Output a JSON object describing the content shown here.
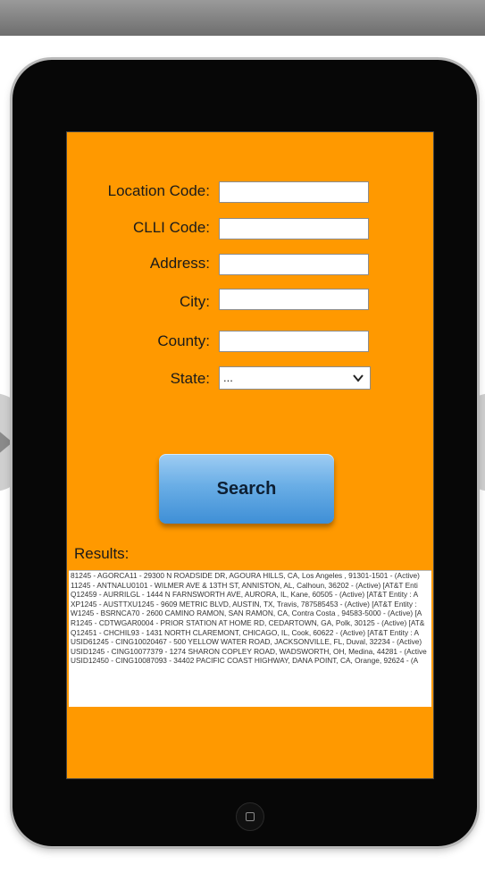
{
  "form": {
    "location_code_label": "Location Code:",
    "clli_code_label": "CLLI Code:",
    "address_label": "Address:",
    "city_label": "City:",
    "county_label": "County:",
    "state_label": "State:",
    "state_selected": "...",
    "search_label": "Search"
  },
  "results": {
    "label": "Results:",
    "rows": [
      "81245 - AGORCA11 - 29300 N ROADSIDE DR, AGOURA HILLS, CA, Los Angeles , 91301-1501 - (Active)",
      "11245 - ANTNALU0101 - WILMER AVE & 13TH ST, ANNISTON, AL, Calhoun, 36202 - (Active) [AT&T Enti",
      "Q12459 - AURRILGL - 1444 N FARNSWORTH AVE, AURORA, IL, Kane, 60505 - (Active) [AT&T Entity : A",
      "XP1245 - AUSTTXU1245 - 9609 METRIC BLVD, AUSTIN, TX, Travis, 787585453 - (Active) [AT&T Entity :",
      "W1245 - BSRNCA70 - 2600 CAMINO RAMON, SAN RAMON, CA, Contra Costa , 94583-5000 - (Active) [A",
      "R1245 - CDTWGAR0004 - PRIOR STATION AT HOME RD, CEDARTOWN, GA, Polk, 30125 - (Active) [AT&",
      "Q12451 - CHCHIL93 - 1431 NORTH CLAREMONT, CHICAGO, IL, Cook, 60622 - (Active) [AT&T Entity : A",
      "USID61245 - CING10020467 - 500 YELLOW WATER ROAD, JACKSONVILLE, FL, Duval, 32234 - (Active)",
      "USID1245 - CING10077379 - 1274 SHARON COPLEY ROAD, WADSWORTH, OH, Medina, 44281 - (Active",
      "USID12450 - CING10087093 - 34402 PACIFIC COAST HIGHWAY, DANA POINT, CA, Orange, 92624 - (A"
    ]
  }
}
